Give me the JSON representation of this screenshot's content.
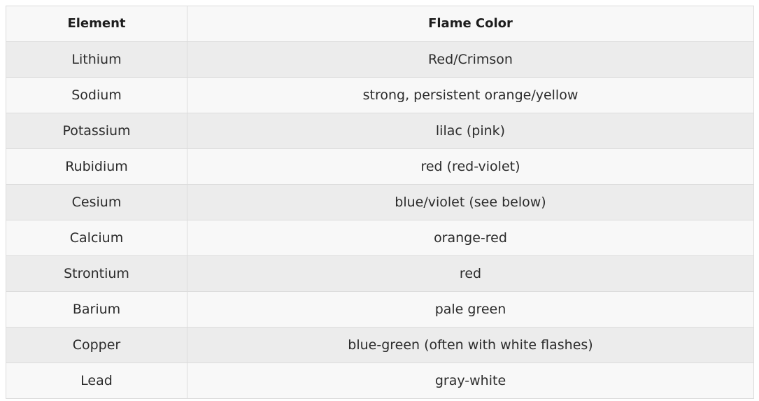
{
  "table": {
    "headers": [
      "Element",
      "Flame Color"
    ],
    "rows": [
      [
        "Lithium",
        "Red/Crimson"
      ],
      [
        "Sodium",
        "strong, persistent orange/yellow"
      ],
      [
        "Potassium",
        "lilac (pink)"
      ],
      [
        "Rubidium",
        "red (red-violet)"
      ],
      [
        "Cesium",
        "blue/violet (see below)"
      ],
      [
        "Calcium",
        "orange-red"
      ],
      [
        "Strontium",
        "red"
      ],
      [
        "Barium",
        "pale green"
      ],
      [
        "Copper",
        "blue-green (often with white flashes)"
      ],
      [
        "Lead",
        "gray-white"
      ]
    ]
  },
  "colors": {
    "row_shaded": "#ececec",
    "row_plain": "#f8f8f8",
    "border": "#dcdcdc",
    "text": "#2b2b2b"
  }
}
